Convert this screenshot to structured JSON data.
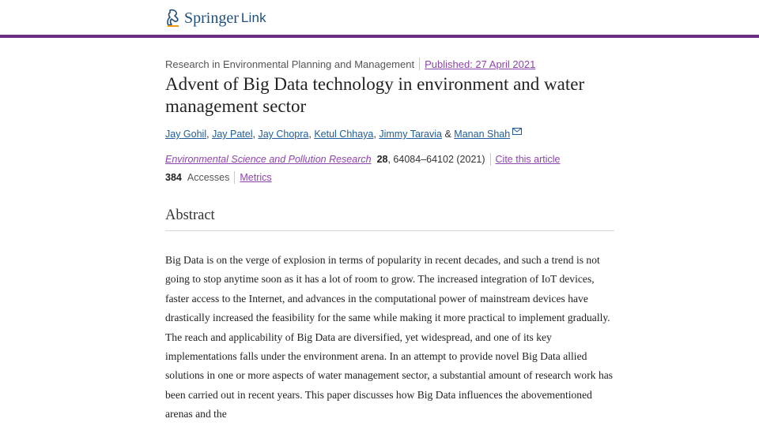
{
  "header": {
    "brand": "Springer",
    "brand_sub": "Link",
    "accent_color": "#6b2c83"
  },
  "article": {
    "series": "Research in Environmental Planning and Management",
    "published": "Published: 27 April 2021",
    "title": "Advent of Big Data technology in environment and water management sector",
    "authors": [
      "Jay Gohil",
      "Jay Patel",
      "Jay Chopra",
      "Ketul Chhaya",
      "Jimmy Taravia",
      "Manan Shah"
    ],
    "author_separator": ", ",
    "author_and": " & ",
    "journal": "Environmental Science and Pollution Research",
    "volume": "28",
    "pages_year": ", 64084–64102 (2021)",
    "cite_label": "Cite this article",
    "accesses_count": "384",
    "accesses_label": "Accesses",
    "metrics_label": "Metrics"
  },
  "abstract": {
    "heading": "Abstract",
    "text": "Big Data is on the verge of explosion in terms of popularity in recent decades, and such a trend is not going to stop anytime soon as it has a lot of room to grow. The increased integration of IoT devices, faster access to the Internet, and advances in the computational power of mainstream devices have drastically increased the feasibility for the same while making it more practical to implement gradually. The reach and applicability of Big Data are diversified, yet widespread, and one of its key implementations falls under the environment arena. In an attempt to provide novel Big Data allied solutions in one or more aspects of water management sector, a substantial amount of research work has been carried out in recent years. This paper discusses how Big Data influences the abovementioned arenas and the"
  },
  "icons": {
    "logo": "springer-horse-icon",
    "mail": "mail-icon"
  }
}
